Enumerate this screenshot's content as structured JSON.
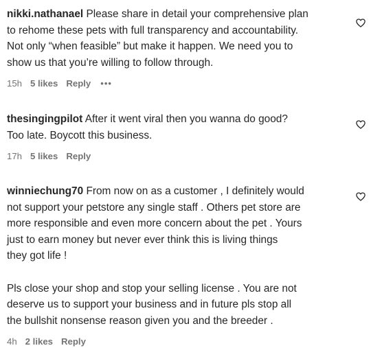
{
  "comments": [
    {
      "username": "nikki.nathanael",
      "text": " Please share in detail your comprehensive plan\nto rehome these pets with full transparency and accountability.\nNot only “when feasible” but make it happen. We need you to\nshow us that you’re willing to follow through.",
      "time": "15h",
      "likes": "5 likes",
      "reply": "Reply",
      "more": "•••"
    },
    {
      "username": "thesingingpilot",
      "text": " After it went viral then you wanna do good?\nToo late. Boycott this business.",
      "time": "17h",
      "likes": "5 likes",
      "reply": "Reply"
    },
    {
      "username": "winniechung70",
      "text": " From now on as a customer , I definitely would\nnot support your petstore any single staff . Others pet store are\nmore responsible and even more concern about the pet . Yours\njust to earn money but never ever think this is living things\nthey got life !\n\nPls close your shop and stop your selling license . You are not\ndeserve us to support your business and in future pls stop all\nthe bullshit nonsense reason given you and the breeder .",
      "time": "4h",
      "likes": "2 likes",
      "reply": "Reply"
    }
  ],
  "icons": {
    "like": "heart-outline-icon",
    "more": "ellipsis-icon"
  },
  "colors": {
    "text": "#262626",
    "secondary": "#737373"
  }
}
